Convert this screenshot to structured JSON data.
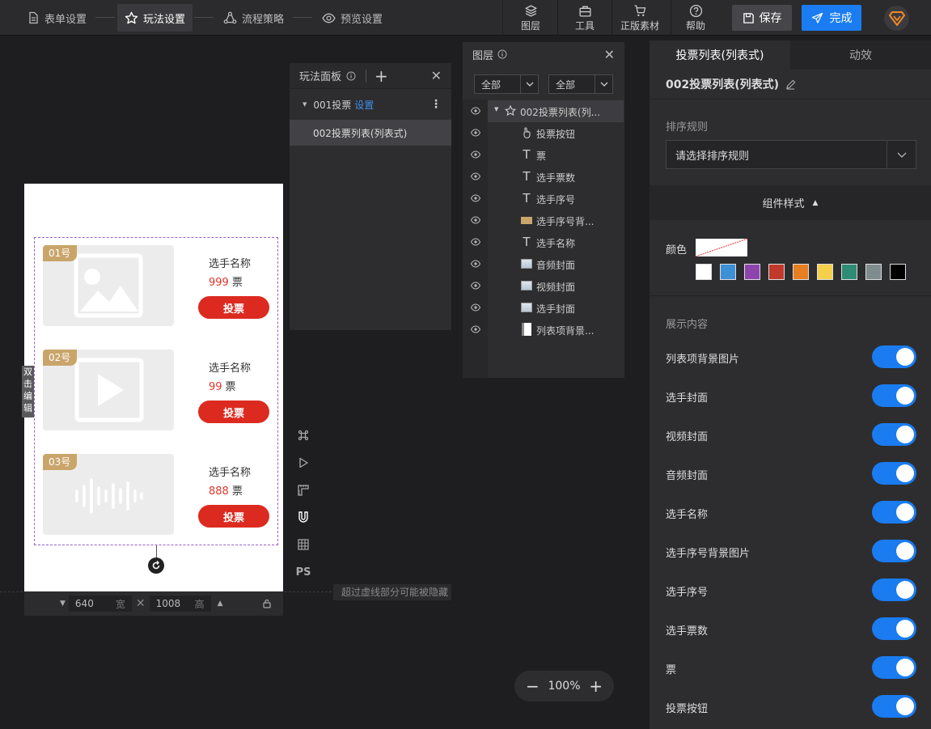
{
  "topbar": {
    "steps": [
      {
        "label": "表单设置"
      },
      {
        "label": "玩法设置"
      },
      {
        "label": "流程策略"
      },
      {
        "label": "预览设置"
      }
    ],
    "tools": [
      {
        "label": "图层"
      },
      {
        "label": "工具"
      },
      {
        "label": "正版素材"
      },
      {
        "label": "帮助"
      }
    ],
    "save_label": "保存",
    "done_label": "完成"
  },
  "canvas": {
    "cards": [
      {
        "badge": "01号",
        "name": "选手名称",
        "votes": "999",
        "unit": "票",
        "button": "投票",
        "media": "image"
      },
      {
        "badge": "02号",
        "name": "选手名称",
        "votes": "99",
        "unit": "票",
        "button": "投票",
        "media": "video"
      },
      {
        "badge": "03号",
        "name": "选手名称",
        "votes": "888",
        "unit": "票",
        "button": "投票",
        "media": "audio"
      }
    ],
    "double_click_hint": "双击编辑",
    "width_value": "640",
    "width_unit": "宽",
    "height_value": "1008",
    "height_unit": "高",
    "overflow_hint": "超过虚线部分可能被隐藏",
    "side_tools": [
      "command-icon",
      "play-icon",
      "ruler-icon",
      "magnet-icon",
      "grid-icon",
      "PS"
    ],
    "zoom": "100%"
  },
  "play_panel": {
    "title": "玩法面板",
    "item1": "001投票",
    "item1_link": "设置",
    "item2": "002投票列表(列表式)"
  },
  "layer_panel": {
    "title": "图层",
    "filter1": "全部",
    "filter2": "全部",
    "layers": [
      {
        "label": "002投票列表(列...",
        "icon": "star-icon"
      },
      {
        "label": "投票按钮",
        "icon": "pointer-icon"
      },
      {
        "label": "票",
        "icon": "text-icon"
      },
      {
        "label": "选手票数",
        "icon": "text-icon"
      },
      {
        "label": "选手序号",
        "icon": "text-icon"
      },
      {
        "label": "选手序号背...",
        "icon": "image-thumb-icon"
      },
      {
        "label": "选手名称",
        "icon": "text-icon"
      },
      {
        "label": "音频封面",
        "icon": "image-icon"
      },
      {
        "label": "视频封面",
        "icon": "image-icon"
      },
      {
        "label": "选手封面",
        "icon": "image-icon"
      },
      {
        "label": "列表项背景...",
        "icon": "bg-image-icon"
      }
    ]
  },
  "right_panel": {
    "tabs": [
      "投票列表(列表式)",
      "动效"
    ],
    "component_title": "002投票列表(列表式)",
    "sort_label": "排序规则",
    "sort_placeholder": "请选择排序规则",
    "style_section": "组件样式",
    "color_label": "颜色",
    "swatches": [
      "#ffffff",
      "#3d8fd6",
      "#8e44ad",
      "#c0392b",
      "#e67e22",
      "#f5d04a",
      "#2e8b74",
      "#7f8c8d",
      "#000000"
    ],
    "display_label": "展示内容",
    "toggles": [
      {
        "label": "列表项背景图片",
        "on": true
      },
      {
        "label": "选手封面",
        "on": true
      },
      {
        "label": "视频封面",
        "on": true
      },
      {
        "label": "音频封面",
        "on": true
      },
      {
        "label": "选手名称",
        "on": true
      },
      {
        "label": "选手序号背景图片",
        "on": true
      },
      {
        "label": "选手序号",
        "on": true
      },
      {
        "label": "选手票数",
        "on": true
      },
      {
        "label": "票",
        "on": true
      },
      {
        "label": "投票按钮",
        "on": true
      }
    ]
  }
}
